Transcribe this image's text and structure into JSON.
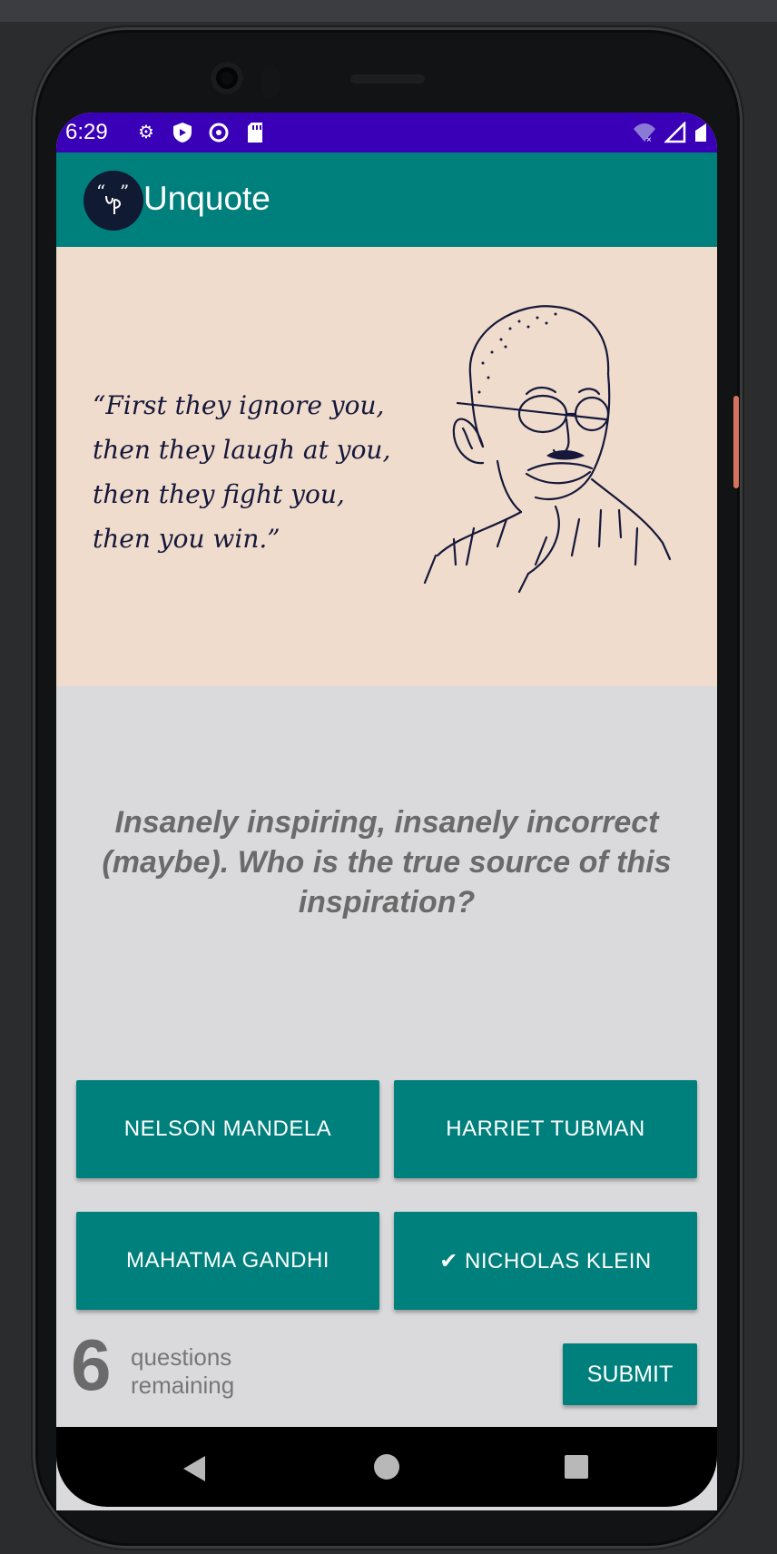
{
  "status_bar": {
    "time": "6:29",
    "icons": [
      "settings-icon",
      "play-protect-icon",
      "data-saver-icon",
      "sd-card-icon"
    ],
    "right_icons": [
      "wifi-icon",
      "signal-icon",
      "battery-icon"
    ],
    "color": "#3a00b8"
  },
  "app_bar": {
    "logo_text": "“ ”",
    "title": "Unquote",
    "color": "#00807c"
  },
  "quote": {
    "lines": [
      "“First they ignore you,",
      "then they laugh at you,",
      "then they fight you,",
      "then you win.”"
    ],
    "image": "portrait-illustration"
  },
  "question": "Insanely inspiring, insanely incorrect (maybe). Who is the true source of this inspiration?",
  "answers": [
    {
      "label": "NELSON MANDELA"
    },
    {
      "label": "HARRIET TUBMAN"
    },
    {
      "label": "MAHATMA GANDHI"
    },
    {
      "label": "✔ NICHOLAS KLEIN",
      "selected": true
    }
  ],
  "footer": {
    "remaining_count": "6",
    "remaining_label_1": "questions",
    "remaining_label_2": "remaining",
    "submit_label": "SUBMIT"
  },
  "nav_bar": {
    "icons": [
      "back-icon",
      "home-icon",
      "recents-icon"
    ]
  }
}
